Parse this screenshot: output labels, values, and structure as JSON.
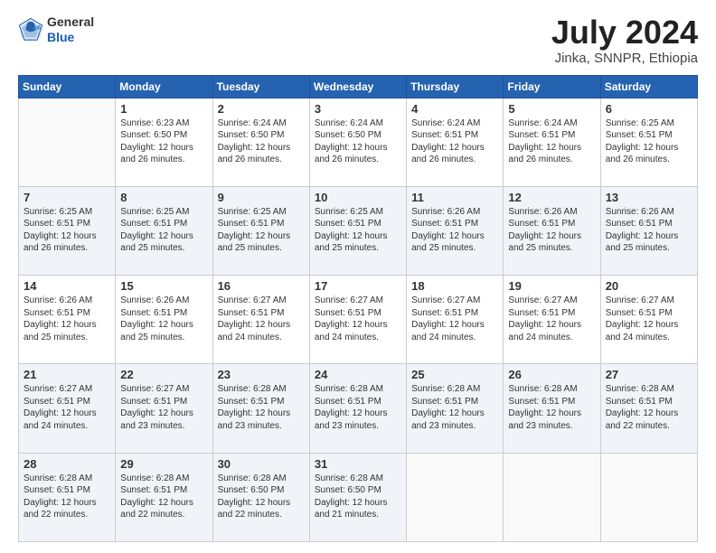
{
  "header": {
    "logo_general": "General",
    "logo_blue": "Blue",
    "month": "July 2024",
    "location": "Jinka, SNNPR, Ethiopia"
  },
  "days_of_week": [
    "Sunday",
    "Monday",
    "Tuesday",
    "Wednesday",
    "Thursday",
    "Friday",
    "Saturday"
  ],
  "weeks": [
    [
      {
        "day": "",
        "info": ""
      },
      {
        "day": "1",
        "info": "Sunrise: 6:23 AM\nSunset: 6:50 PM\nDaylight: 12 hours\nand 26 minutes."
      },
      {
        "day": "2",
        "info": "Sunrise: 6:24 AM\nSunset: 6:50 PM\nDaylight: 12 hours\nand 26 minutes."
      },
      {
        "day": "3",
        "info": "Sunrise: 6:24 AM\nSunset: 6:50 PM\nDaylight: 12 hours\nand 26 minutes."
      },
      {
        "day": "4",
        "info": "Sunrise: 6:24 AM\nSunset: 6:51 PM\nDaylight: 12 hours\nand 26 minutes."
      },
      {
        "day": "5",
        "info": "Sunrise: 6:24 AM\nSunset: 6:51 PM\nDaylight: 12 hours\nand 26 minutes."
      },
      {
        "day": "6",
        "info": "Sunrise: 6:25 AM\nSunset: 6:51 PM\nDaylight: 12 hours\nand 26 minutes."
      }
    ],
    [
      {
        "day": "7",
        "info": "Sunrise: 6:25 AM\nSunset: 6:51 PM\nDaylight: 12 hours\nand 26 minutes."
      },
      {
        "day": "8",
        "info": "Sunrise: 6:25 AM\nSunset: 6:51 PM\nDaylight: 12 hours\nand 25 minutes."
      },
      {
        "day": "9",
        "info": "Sunrise: 6:25 AM\nSunset: 6:51 PM\nDaylight: 12 hours\nand 25 minutes."
      },
      {
        "day": "10",
        "info": "Sunrise: 6:25 AM\nSunset: 6:51 PM\nDaylight: 12 hours\nand 25 minutes."
      },
      {
        "day": "11",
        "info": "Sunrise: 6:26 AM\nSunset: 6:51 PM\nDaylight: 12 hours\nand 25 minutes."
      },
      {
        "day": "12",
        "info": "Sunrise: 6:26 AM\nSunset: 6:51 PM\nDaylight: 12 hours\nand 25 minutes."
      },
      {
        "day": "13",
        "info": "Sunrise: 6:26 AM\nSunset: 6:51 PM\nDaylight: 12 hours\nand 25 minutes."
      }
    ],
    [
      {
        "day": "14",
        "info": "Sunrise: 6:26 AM\nSunset: 6:51 PM\nDaylight: 12 hours\nand 25 minutes."
      },
      {
        "day": "15",
        "info": "Sunrise: 6:26 AM\nSunset: 6:51 PM\nDaylight: 12 hours\nand 25 minutes."
      },
      {
        "day": "16",
        "info": "Sunrise: 6:27 AM\nSunset: 6:51 PM\nDaylight: 12 hours\nand 24 minutes."
      },
      {
        "day": "17",
        "info": "Sunrise: 6:27 AM\nSunset: 6:51 PM\nDaylight: 12 hours\nand 24 minutes."
      },
      {
        "day": "18",
        "info": "Sunrise: 6:27 AM\nSunset: 6:51 PM\nDaylight: 12 hours\nand 24 minutes."
      },
      {
        "day": "19",
        "info": "Sunrise: 6:27 AM\nSunset: 6:51 PM\nDaylight: 12 hours\nand 24 minutes."
      },
      {
        "day": "20",
        "info": "Sunrise: 6:27 AM\nSunset: 6:51 PM\nDaylight: 12 hours\nand 24 minutes."
      }
    ],
    [
      {
        "day": "21",
        "info": "Sunrise: 6:27 AM\nSunset: 6:51 PM\nDaylight: 12 hours\nand 24 minutes."
      },
      {
        "day": "22",
        "info": "Sunrise: 6:27 AM\nSunset: 6:51 PM\nDaylight: 12 hours\nand 23 minutes."
      },
      {
        "day": "23",
        "info": "Sunrise: 6:28 AM\nSunset: 6:51 PM\nDaylight: 12 hours\nand 23 minutes."
      },
      {
        "day": "24",
        "info": "Sunrise: 6:28 AM\nSunset: 6:51 PM\nDaylight: 12 hours\nand 23 minutes."
      },
      {
        "day": "25",
        "info": "Sunrise: 6:28 AM\nSunset: 6:51 PM\nDaylight: 12 hours\nand 23 minutes."
      },
      {
        "day": "26",
        "info": "Sunrise: 6:28 AM\nSunset: 6:51 PM\nDaylight: 12 hours\nand 23 minutes."
      },
      {
        "day": "27",
        "info": "Sunrise: 6:28 AM\nSunset: 6:51 PM\nDaylight: 12 hours\nand 22 minutes."
      }
    ],
    [
      {
        "day": "28",
        "info": "Sunrise: 6:28 AM\nSunset: 6:51 PM\nDaylight: 12 hours\nand 22 minutes."
      },
      {
        "day": "29",
        "info": "Sunrise: 6:28 AM\nSunset: 6:51 PM\nDaylight: 12 hours\nand 22 minutes."
      },
      {
        "day": "30",
        "info": "Sunrise: 6:28 AM\nSunset: 6:50 PM\nDaylight: 12 hours\nand 22 minutes."
      },
      {
        "day": "31",
        "info": "Sunrise: 6:28 AM\nSunset: 6:50 PM\nDaylight: 12 hours\nand 21 minutes."
      },
      {
        "day": "",
        "info": ""
      },
      {
        "day": "",
        "info": ""
      },
      {
        "day": "",
        "info": ""
      }
    ]
  ]
}
